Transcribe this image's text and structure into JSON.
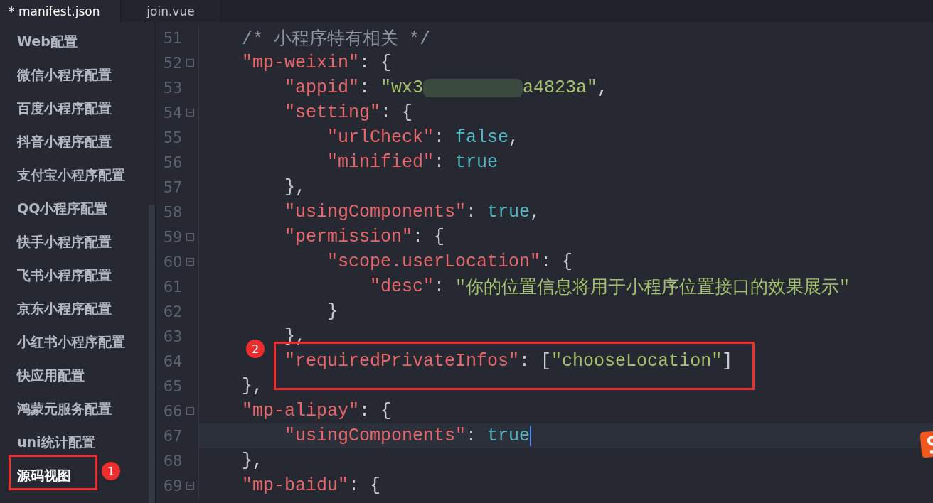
{
  "tabs": [
    {
      "label": "* manifest.json",
      "selected": true
    },
    {
      "label": "join.vue",
      "selected": false
    }
  ],
  "sidebar": {
    "items": [
      {
        "label": "Web配置",
        "selected": false
      },
      {
        "label": "微信小程序配置",
        "selected": false
      },
      {
        "label": "百度小程序配置",
        "selected": false
      },
      {
        "label": "抖音小程序配置",
        "selected": false
      },
      {
        "label": "支付宝小程序配置",
        "selected": false
      },
      {
        "label": "QQ小程序配置",
        "selected": false
      },
      {
        "label": "快手小程序配置",
        "selected": false
      },
      {
        "label": "飞书小程序配置",
        "selected": false
      },
      {
        "label": "京东小程序配置",
        "selected": false
      },
      {
        "label": "小红书小程序配置",
        "selected": false
      },
      {
        "label": "快应用配置",
        "selected": false
      },
      {
        "label": "鸿蒙元服务配置",
        "selected": false
      },
      {
        "label": "uni统计配置",
        "selected": false
      },
      {
        "label": "源码视图",
        "selected": true
      }
    ]
  },
  "editor": {
    "lines": [
      {
        "number": "51",
        "fold": false,
        "current": false,
        "tokens": [
          {
            "kind": "comment",
            "text": "    /* 小程序特有相关 */"
          }
        ]
      },
      {
        "number": "52",
        "fold": true,
        "current": false,
        "tokens": [
          {
            "kind": "key",
            "text": "    \"mp-weixin\""
          },
          {
            "kind": "punct",
            "text": ": {"
          }
        ]
      },
      {
        "number": "53",
        "fold": false,
        "current": false,
        "tokens": [
          {
            "kind": "key",
            "text": "        \"appid\""
          },
          {
            "kind": "punct",
            "text": ": "
          },
          {
            "kind": "string",
            "text": "\"wx3"
          },
          {
            "kind": "redacted"
          },
          {
            "kind": "string",
            "text": "a4823a\""
          },
          {
            "kind": "punct",
            "text": ","
          }
        ]
      },
      {
        "number": "54",
        "fold": true,
        "current": false,
        "tokens": [
          {
            "kind": "key",
            "text": "        \"setting\""
          },
          {
            "kind": "punct",
            "text": ": {"
          }
        ]
      },
      {
        "number": "55",
        "fold": false,
        "current": false,
        "tokens": [
          {
            "kind": "key",
            "text": "            \"urlCheck\""
          },
          {
            "kind": "punct",
            "text": ": "
          },
          {
            "kind": "literal",
            "text": "false"
          },
          {
            "kind": "punct",
            "text": ","
          }
        ]
      },
      {
        "number": "56",
        "fold": false,
        "current": false,
        "tokens": [
          {
            "kind": "key",
            "text": "            \"minified\""
          },
          {
            "kind": "punct",
            "text": ": "
          },
          {
            "kind": "literal",
            "text": "true"
          }
        ]
      },
      {
        "number": "57",
        "fold": false,
        "current": false,
        "tokens": [
          {
            "kind": "punct",
            "text": "        },"
          }
        ]
      },
      {
        "number": "58",
        "fold": false,
        "current": false,
        "tokens": [
          {
            "kind": "key",
            "text": "        \"usingComponents\""
          },
          {
            "kind": "punct",
            "text": ": "
          },
          {
            "kind": "literal",
            "text": "true"
          },
          {
            "kind": "punct",
            "text": ","
          }
        ]
      },
      {
        "number": "59",
        "fold": true,
        "current": false,
        "tokens": [
          {
            "kind": "key",
            "text": "        \"permission\""
          },
          {
            "kind": "punct",
            "text": ": {"
          }
        ]
      },
      {
        "number": "60",
        "fold": true,
        "current": false,
        "tokens": [
          {
            "kind": "key",
            "text": "            \"scope.userLocation\""
          },
          {
            "kind": "punct",
            "text": ": {"
          }
        ]
      },
      {
        "number": "61",
        "fold": false,
        "current": false,
        "tokens": [
          {
            "kind": "key",
            "text": "                \"desc\""
          },
          {
            "kind": "punct",
            "text": ": "
          },
          {
            "kind": "string",
            "text": "\"你的位置信息将用于小程序位置接口的效果展示\""
          }
        ]
      },
      {
        "number": "62",
        "fold": false,
        "current": false,
        "tokens": [
          {
            "kind": "punct",
            "text": "            }"
          }
        ]
      },
      {
        "number": "63",
        "fold": false,
        "current": false,
        "tokens": [
          {
            "kind": "punct",
            "text": "        },"
          }
        ]
      },
      {
        "number": "64",
        "fold": false,
        "current": false,
        "tokens": [
          {
            "kind": "key",
            "text": "        \"requiredPrivateInfos\""
          },
          {
            "kind": "punct",
            "text": ": ["
          },
          {
            "kind": "string",
            "text": "\"chooseLocation\""
          },
          {
            "kind": "punct",
            "text": "]"
          }
        ]
      },
      {
        "number": "65",
        "fold": false,
        "current": false,
        "tokens": [
          {
            "kind": "punct",
            "text": "    },"
          }
        ]
      },
      {
        "number": "66",
        "fold": true,
        "current": false,
        "tokens": [
          {
            "kind": "key",
            "text": "    \"mp-alipay\""
          },
          {
            "kind": "punct",
            "text": ": {"
          }
        ]
      },
      {
        "number": "67",
        "fold": false,
        "current": true,
        "tokens": [
          {
            "kind": "key",
            "text": "        \"usingComponents\""
          },
          {
            "kind": "punct",
            "text": ": "
          },
          {
            "kind": "literal",
            "text": "true"
          }
        ]
      },
      {
        "number": "68",
        "fold": false,
        "current": false,
        "tokens": [
          {
            "kind": "punct",
            "text": "    },"
          }
        ]
      },
      {
        "number": "69",
        "fold": true,
        "current": false,
        "tokens": [
          {
            "kind": "key",
            "text": "    \"mp-baidu\""
          },
          {
            "kind": "punct",
            "text": ": {"
          }
        ]
      }
    ]
  },
  "annotations": [
    {
      "label": "1"
    },
    {
      "label": "2"
    }
  ]
}
